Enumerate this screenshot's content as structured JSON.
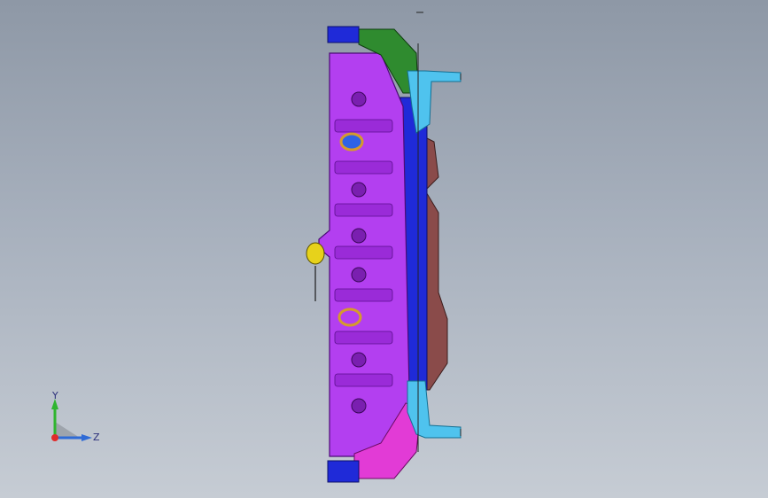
{
  "viewport": {
    "background_top": "#8e98a6",
    "background_bottom": "#c6ccd4"
  },
  "model": {
    "colors": {
      "main_panel": "#b33ff0",
      "panel_dark": "#7a1fb0",
      "blue_rail": "#1f2ad8",
      "cyan_bracket": "#4fc3ee",
      "brown_bracket": "#8a4b4a",
      "green_top": "#2f8b2f",
      "magenta_bottom": "#e23bd6",
      "yellow_part": "#e7d21b"
    }
  },
  "triad": {
    "y_label": "Y",
    "z_label": "Z",
    "icon": "coordinate-triad-icon"
  }
}
